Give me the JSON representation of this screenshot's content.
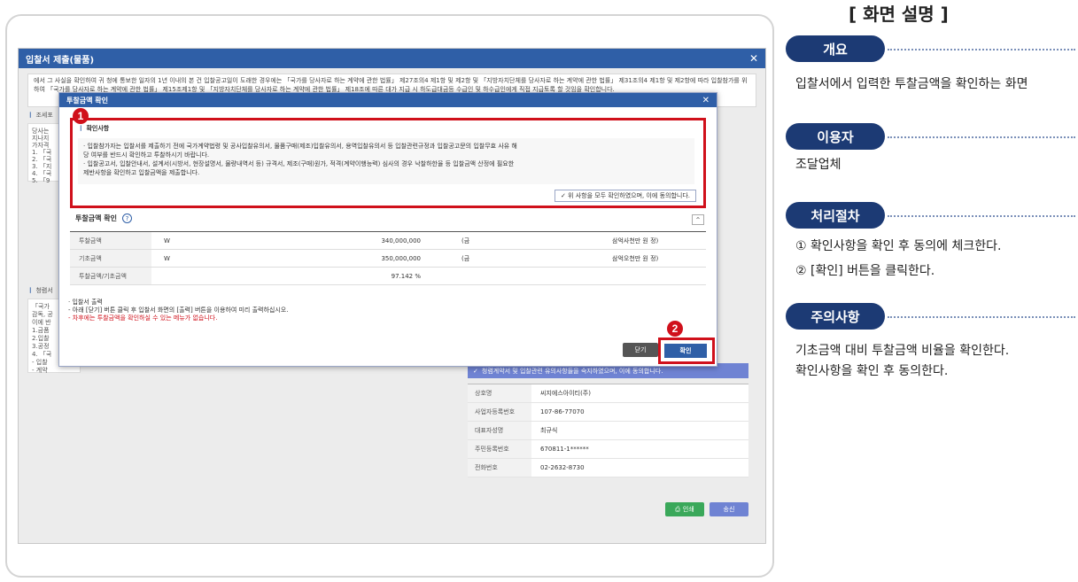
{
  "outer": {
    "title": "입찰서 제출(물품)",
    "notice": "에서 그 사실을 확인하여 귀 청에 통보한 일자의 1년 이내의 본 건 입찰공고일이 도래한 경우에는 「국가를 당사자로 하는 계약에 관한 법률」 제27조의4 제1항 및 제2항 및 「지방자치단체를 당사자로 하는 계약에 관한 법률」 제31조의4 제1항 및 제2항에 따라 입찰참가를 위하여 「국가를 당사자로 하는 계약에 관한 법률」 제15조제1항 및 「지방자치단체를 당사자로 하는 계약에 관한 법률」 제18조에 따른 대가 지급 시 하도급대금등 수급인 및 하수급인에게 직접 지급토록 할 것임을 확인합니다.",
    "sec1": "조세포",
    "sec1_lines": [
      "당사는",
      "지나지",
      "가자격",
      "1. 「국",
      "2. 「국",
      "3. 「지",
      "4. 「국",
      "5. 「9"
    ],
    "sec2": "청렴서",
    "sec2_lines": [
      "「국가",
      "감독, 공",
      "이에 반",
      "1.금품",
      "2.입찰",
      "3.공정",
      "4. 「국",
      "- 입찰",
      "- 계약"
    ],
    "agree_bar": "청렴계약서 및 입찰관련 유의사항들을 숙지하였으며, 이에 동의합니다.",
    "info": [
      {
        "k": "상호명",
        "v": "씨지에스아이티(주)"
      },
      {
        "k": "사업자등록번호",
        "v": "107-86-77070"
      },
      {
        "k": "대표자성명",
        "v": "최규식"
      },
      {
        "k": "주민등록번호",
        "v": "670811-1******"
      },
      {
        "k": "전화번호",
        "v": "02-2632-8730"
      }
    ],
    "btn_print": "인쇄",
    "btn_send": "송신"
  },
  "modal": {
    "title": "투찰금액 확인",
    "confirm_head": "확인사항",
    "confirm_lines": [
      "· 입찰참가자는 입찰서를 제출하기 전에 국가계약법령 및 공사입찰유의서, 물품구매(제조)입찰유의서, 용역입찰유의서 등 입찰관련규정과 입찰공고문의 입찰무효 사유 해",
      "  당 여부를 반드시 확인하고 투찰하시기 바랍니다.",
      "· 입찰공고서, 입찰안내서, 설계서(시방서, 현장설명서, 물량내역서 등) 규격서, 제조(구매)원가, 적격(계약이행능력) 심사의 경우 낙찰하한율 등 입찰금액 산정에 필요한",
      "  제반사항을 확인하고 입찰금액을 제출합니다."
    ],
    "agree_btn": "✓ 위 사항을 모두 확인하였으며, 이에 동의합니다.",
    "bid_head": "투찰금액 확인",
    "rows": [
      {
        "label": "투찰금액",
        "cur": "W",
        "amount": "340,000,000",
        "paren": "(금",
        "korean": "삼억사천만  원 정)"
      },
      {
        "label": "기초금액",
        "cur": "W",
        "amount": "350,000,000",
        "paren": "(금",
        "korean": "삼억오천만  원 정)"
      },
      {
        "label": "투찰금액/기초금액",
        "cur": "",
        "amount": "97.142  %",
        "paren": "",
        "korean": ""
      }
    ],
    "print_head": "· 입찰서 출력",
    "print_line1": "- 아래 [닫기] 버튼 클릭 후 입찰서 화면의 [출력] 버튼을 이용하여 미리 출력하십시오.",
    "print_line2": "- 차후에는 투찰금액을 확인하실 수 있는 메뉴가 없습니다.",
    "btn_close": "닫기",
    "btn_ok": "확인"
  },
  "badges": {
    "one": "1",
    "two": "2"
  },
  "panel": {
    "title": "[ 화면 설명 ]",
    "overview_label": "개요",
    "overview_text": "입찰서에서 입력한 투찰금액을 확인하는 화면",
    "user_label": "이용자",
    "user_text": "조달업체",
    "proc_label": "처리절차",
    "proc_1": "① 확인사항을 확인 후 동의에 체크한다.",
    "proc_2": "② [확인] 버튼을 클릭한다.",
    "caution_label": "주의사항",
    "caution_1": "기초금액 대비 투찰금액 비율을 확인한다.",
    "caution_2": "확인사항을 확인 후 동의한다."
  },
  "colors": {
    "accent": "#1c3a74",
    "highlight": "#d0101b",
    "titlebar": "#2f5fa7"
  }
}
